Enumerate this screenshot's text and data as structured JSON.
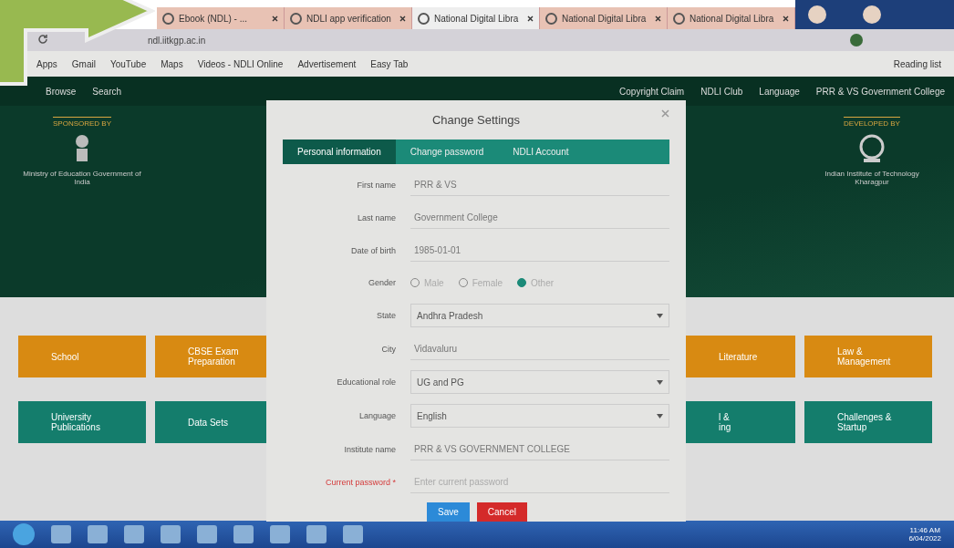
{
  "browser": {
    "tabs": [
      {
        "title": "Ebook (NDL) - ...",
        "selected": false
      },
      {
        "title": "NDLI app verification",
        "selected": false
      },
      {
        "title": "National Digital Libra",
        "selected": true
      },
      {
        "title": "National Digital Libra",
        "selected": false
      },
      {
        "title": "National Digital Libra",
        "selected": false
      }
    ],
    "address": "ndl.iitkgp.ac.in",
    "bookmarks": [
      "Apps",
      "Gmail",
      "YouTube",
      "Maps",
      "Videos - NDLI Online",
      "Advertisement",
      "Easy Tab"
    ],
    "reading_list": "Reading list"
  },
  "navbar": {
    "left": [
      "Browse",
      "Search"
    ],
    "right": [
      "Copyright Claim",
      "NDLI Club",
      "Language",
      "PRR & VS Government College"
    ]
  },
  "hero": {
    "sponsor_heading": "SPONSORED BY",
    "sponsor": "Ministry of Education Government of India",
    "developer_heading": "DEVELOPED BY",
    "developer": "Indian Institute of Technology Kharagpur"
  },
  "tiles": [
    {
      "kind": "orange",
      "lines": [
        "School"
      ]
    },
    {
      "kind": "orange",
      "lines": [
        "CBSE Exam",
        "Preparation"
      ]
    },
    {
      "kind": "orange",
      "lines": [
        "Literature"
      ]
    },
    {
      "kind": "orange",
      "lines": [
        "Law &",
        "Management"
      ]
    },
    {
      "kind": "teal",
      "lines": [
        "University",
        "Publications"
      ]
    },
    {
      "kind": "teal",
      "lines": [
        "Data Sets"
      ]
    },
    {
      "kind": "teal",
      "lines": [
        "l &",
        "ing"
      ]
    },
    {
      "kind": "teal",
      "lines": [
        "Challenges &",
        "Startup"
      ]
    }
  ],
  "modal": {
    "title": "Change Settings",
    "tabs": [
      {
        "label": "Personal information",
        "selected": true
      },
      {
        "label": "Change password",
        "selected": false
      },
      {
        "label": "NDLI Account",
        "selected": false
      }
    ],
    "fields": [
      {
        "kind": "text",
        "label": "First name",
        "value": "PRR & VS"
      },
      {
        "kind": "text",
        "label": "Last name",
        "value": "Government College"
      },
      {
        "kind": "text",
        "label": "Date of birth",
        "value": "1985-01-01"
      },
      {
        "kind": "radio",
        "label": "Gender",
        "options": [
          {
            "label": "Male",
            "selected": false
          },
          {
            "label": "Female",
            "selected": false
          },
          {
            "label": "Other",
            "selected": true
          }
        ]
      },
      {
        "kind": "select",
        "label": "State",
        "value": "Andhra Pradesh"
      },
      {
        "kind": "text",
        "label": "City",
        "value": "Vidavaluru"
      },
      {
        "kind": "select",
        "label": "Educational role",
        "value": "UG and PG"
      },
      {
        "kind": "select",
        "label": "Language",
        "value": "English"
      },
      {
        "kind": "text",
        "label": "Institute name",
        "value": "PRR & VS GOVERNMENT COLLEGE"
      },
      {
        "kind": "password",
        "label": "Current password *",
        "placeholder": "Enter current password",
        "required": true
      }
    ],
    "buttons": [
      {
        "kind": "primary",
        "label": "Save"
      },
      {
        "kind": "danger",
        "label": "Cancel"
      }
    ]
  },
  "taskbar": {
    "time": "11:46 AM",
    "date": "6/04/2022"
  }
}
